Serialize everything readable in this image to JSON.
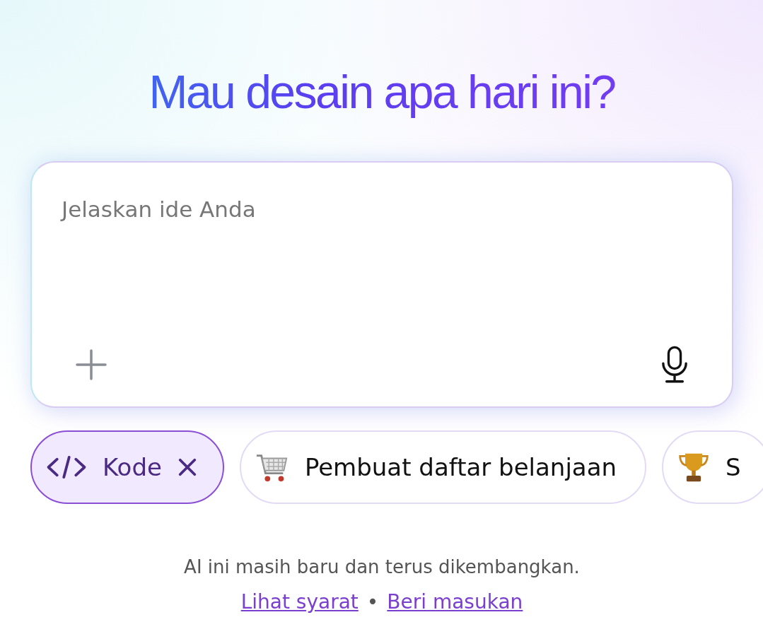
{
  "heading": "Mau desain apa hari ini?",
  "prompt": {
    "placeholder": "Jelaskan ide Anda"
  },
  "chips": [
    {
      "kind": "code",
      "label": "Kode",
      "selected": true
    },
    {
      "kind": "cart",
      "label": "Pembuat daftar belanjaan",
      "selected": false
    },
    {
      "kind": "trophy",
      "label": "S",
      "selected": false
    }
  ],
  "disclaimer": "AI ini masih baru dan terus dikembangkan.",
  "links": [
    "Lihat syarat",
    "Beri masukan"
  ],
  "separator": "•"
}
